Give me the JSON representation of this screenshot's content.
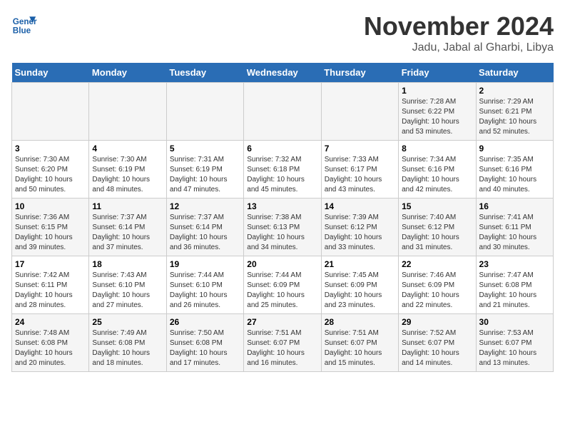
{
  "header": {
    "logo_line1": "General",
    "logo_line2": "Blue",
    "month": "November 2024",
    "location": "Jadu, Jabal al Gharbi, Libya"
  },
  "weekdays": [
    "Sunday",
    "Monday",
    "Tuesday",
    "Wednesday",
    "Thursday",
    "Friday",
    "Saturday"
  ],
  "weeks": [
    [
      {
        "day": "",
        "info": ""
      },
      {
        "day": "",
        "info": ""
      },
      {
        "day": "",
        "info": ""
      },
      {
        "day": "",
        "info": ""
      },
      {
        "day": "",
        "info": ""
      },
      {
        "day": "1",
        "info": "Sunrise: 7:28 AM\nSunset: 6:22 PM\nDaylight: 10 hours\nand 53 minutes."
      },
      {
        "day": "2",
        "info": "Sunrise: 7:29 AM\nSunset: 6:21 PM\nDaylight: 10 hours\nand 52 minutes."
      }
    ],
    [
      {
        "day": "3",
        "info": "Sunrise: 7:30 AM\nSunset: 6:20 PM\nDaylight: 10 hours\nand 50 minutes."
      },
      {
        "day": "4",
        "info": "Sunrise: 7:30 AM\nSunset: 6:19 PM\nDaylight: 10 hours\nand 48 minutes."
      },
      {
        "day": "5",
        "info": "Sunrise: 7:31 AM\nSunset: 6:19 PM\nDaylight: 10 hours\nand 47 minutes."
      },
      {
        "day": "6",
        "info": "Sunrise: 7:32 AM\nSunset: 6:18 PM\nDaylight: 10 hours\nand 45 minutes."
      },
      {
        "day": "7",
        "info": "Sunrise: 7:33 AM\nSunset: 6:17 PM\nDaylight: 10 hours\nand 43 minutes."
      },
      {
        "day": "8",
        "info": "Sunrise: 7:34 AM\nSunset: 6:16 PM\nDaylight: 10 hours\nand 42 minutes."
      },
      {
        "day": "9",
        "info": "Sunrise: 7:35 AM\nSunset: 6:16 PM\nDaylight: 10 hours\nand 40 minutes."
      }
    ],
    [
      {
        "day": "10",
        "info": "Sunrise: 7:36 AM\nSunset: 6:15 PM\nDaylight: 10 hours\nand 39 minutes."
      },
      {
        "day": "11",
        "info": "Sunrise: 7:37 AM\nSunset: 6:14 PM\nDaylight: 10 hours\nand 37 minutes."
      },
      {
        "day": "12",
        "info": "Sunrise: 7:37 AM\nSunset: 6:14 PM\nDaylight: 10 hours\nand 36 minutes."
      },
      {
        "day": "13",
        "info": "Sunrise: 7:38 AM\nSunset: 6:13 PM\nDaylight: 10 hours\nand 34 minutes."
      },
      {
        "day": "14",
        "info": "Sunrise: 7:39 AM\nSunset: 6:12 PM\nDaylight: 10 hours\nand 33 minutes."
      },
      {
        "day": "15",
        "info": "Sunrise: 7:40 AM\nSunset: 6:12 PM\nDaylight: 10 hours\nand 31 minutes."
      },
      {
        "day": "16",
        "info": "Sunrise: 7:41 AM\nSunset: 6:11 PM\nDaylight: 10 hours\nand 30 minutes."
      }
    ],
    [
      {
        "day": "17",
        "info": "Sunrise: 7:42 AM\nSunset: 6:11 PM\nDaylight: 10 hours\nand 28 minutes."
      },
      {
        "day": "18",
        "info": "Sunrise: 7:43 AM\nSunset: 6:10 PM\nDaylight: 10 hours\nand 27 minutes."
      },
      {
        "day": "19",
        "info": "Sunrise: 7:44 AM\nSunset: 6:10 PM\nDaylight: 10 hours\nand 26 minutes."
      },
      {
        "day": "20",
        "info": "Sunrise: 7:44 AM\nSunset: 6:09 PM\nDaylight: 10 hours\nand 25 minutes."
      },
      {
        "day": "21",
        "info": "Sunrise: 7:45 AM\nSunset: 6:09 PM\nDaylight: 10 hours\nand 23 minutes."
      },
      {
        "day": "22",
        "info": "Sunrise: 7:46 AM\nSunset: 6:09 PM\nDaylight: 10 hours\nand 22 minutes."
      },
      {
        "day": "23",
        "info": "Sunrise: 7:47 AM\nSunset: 6:08 PM\nDaylight: 10 hours\nand 21 minutes."
      }
    ],
    [
      {
        "day": "24",
        "info": "Sunrise: 7:48 AM\nSunset: 6:08 PM\nDaylight: 10 hours\nand 20 minutes."
      },
      {
        "day": "25",
        "info": "Sunrise: 7:49 AM\nSunset: 6:08 PM\nDaylight: 10 hours\nand 18 minutes."
      },
      {
        "day": "26",
        "info": "Sunrise: 7:50 AM\nSunset: 6:08 PM\nDaylight: 10 hours\nand 17 minutes."
      },
      {
        "day": "27",
        "info": "Sunrise: 7:51 AM\nSunset: 6:07 PM\nDaylight: 10 hours\nand 16 minutes."
      },
      {
        "day": "28",
        "info": "Sunrise: 7:51 AM\nSunset: 6:07 PM\nDaylight: 10 hours\nand 15 minutes."
      },
      {
        "day": "29",
        "info": "Sunrise: 7:52 AM\nSunset: 6:07 PM\nDaylight: 10 hours\nand 14 minutes."
      },
      {
        "day": "30",
        "info": "Sunrise: 7:53 AM\nSunset: 6:07 PM\nDaylight: 10 hours\nand 13 minutes."
      }
    ]
  ]
}
